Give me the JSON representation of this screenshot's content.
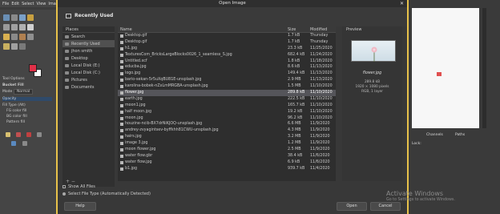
{
  "gimp": {
    "menu": [
      "File",
      "Edit",
      "Select",
      "View",
      "Image"
    ],
    "tool_options_tab": "Tool Options",
    "bucket_fill": "Bucket Fill",
    "mode_label": "Mode",
    "mode_value": "Normal",
    "opacity_label": "Opacity",
    "fill_type_label": "Fill Type (Alt)",
    "fill_options": [
      "FG color fill",
      "BG color fill",
      "Pattern fill"
    ],
    "right_tabs": [
      "Channels",
      "Paths"
    ],
    "lock_label": "Lock:"
  },
  "dialog": {
    "title": "Open Image",
    "location_title": "Recently Used",
    "places_header": "Places",
    "places": [
      {
        "label": "Search",
        "selected": false
      },
      {
        "label": "Recently Used",
        "selected": true
      },
      {
        "label": "jhon smith",
        "selected": false
      },
      {
        "label": "Desktop",
        "selected": false
      },
      {
        "label": "Local Disk (E:)",
        "selected": false
      },
      {
        "label": "Local Disk (C:)",
        "selected": false
      },
      {
        "label": "Pictures",
        "selected": false
      },
      {
        "label": "Documents",
        "selected": false
      }
    ],
    "columns": {
      "name": "Name",
      "size": "Size",
      "modified": "Modified"
    },
    "files": [
      {
        "name": "Desktop.gif",
        "size": "1.7 kB",
        "modified": "Thursday",
        "selected": false
      },
      {
        "name": "Desktop.gif",
        "size": "1.7 kB",
        "modified": "Thursday",
        "selected": false
      },
      {
        "name": "h1.jpg",
        "size": "23.3 kB",
        "modified": "11/25/2020",
        "selected": false
      },
      {
        "name": "TexturesCom_BricksLargeBlocks0026_1_seamless_S.jpg",
        "size": "682.4 kB",
        "modified": "11/24/2020",
        "selected": false
      },
      {
        "name": "Untitled.xcf",
        "size": "1.8 kB",
        "modified": "11/18/2020",
        "selected": false
      },
      {
        "name": "educba.jpg",
        "size": "8.6 kB",
        "modified": "11/13/2020",
        "selected": false
      },
      {
        "name": "logo.jpg",
        "size": "149.4 kB",
        "modified": "11/13/2020",
        "selected": false
      },
      {
        "name": "bario-sekan-5r5uXqBU81E-unsplash.jpg",
        "size": "2.9 MB",
        "modified": "11/13/2020",
        "selected": false
      },
      {
        "name": "karolina-bobek-nZxLmMRGBA-unsplash.jpg",
        "size": "1.5 MB",
        "modified": "11/10/2020",
        "selected": false
      },
      {
        "name": "flower.jpg",
        "size": "289.8 kB",
        "modified": "11/10/2020",
        "selected": true
      },
      {
        "name": "earth.jpg",
        "size": "222.5 kB",
        "modified": "11/10/2020",
        "selected": false
      },
      {
        "name": "moon1.jpg",
        "size": "165.7 kB",
        "modified": "11/10/2020",
        "selected": false
      },
      {
        "name": "half moon.jpg",
        "size": "19.2 kB",
        "modified": "11/10/2020",
        "selected": false
      },
      {
        "name": "moon.jpg",
        "size": "96.2 kB",
        "modified": "11/10/2020",
        "selected": false
      },
      {
        "name": "houzine-ncib-BX7drNiKJOQ-unsplash.jpg",
        "size": "6.6 MB",
        "modified": "11/9/2020",
        "selected": false
      },
      {
        "name": "andrey-zvyagintsev-byffkhh81CWU-unsplash.jpg",
        "size": "4.3 MB",
        "modified": "11/9/2020",
        "selected": false
      },
      {
        "name": "hairs.jpg",
        "size": "3.2 MB",
        "modified": "11/9/2020",
        "selected": false
      },
      {
        "name": "image 3.jpg",
        "size": "1.2 MB",
        "modified": "11/9/2020",
        "selected": false
      },
      {
        "name": "moon flower.jpg",
        "size": "2.5 MB",
        "modified": "11/9/2020",
        "selected": false
      },
      {
        "name": "water flow.gbr",
        "size": "38.4 kB",
        "modified": "11/6/2020",
        "selected": false
      },
      {
        "name": "water flow.jpg",
        "size": "6.9 kB",
        "modified": "11/6/2020",
        "selected": false
      },
      {
        "name": "b1.jpg",
        "size": "939.7 kB",
        "modified": "11/4/2020",
        "selected": false
      }
    ],
    "preview": {
      "label": "Preview",
      "filename": "flower.jpg",
      "size": "289.8 kB",
      "dimensions": "1920 × 1080 pixels",
      "mode": "RGB, 1 layer"
    },
    "show_all_files": "Show All Files",
    "file_type": "Select File Type (Automatically Detected)",
    "help_button": "Help",
    "open_button": "Open",
    "cancel_button": "Cancel"
  },
  "watermark": {
    "line1": "Activate Windows",
    "line2": "Go to Settings to activate Windows."
  },
  "colors": {
    "frame": "#e8c24a",
    "fg_color": "#e03048",
    "canvas_mark": "#e05050"
  }
}
